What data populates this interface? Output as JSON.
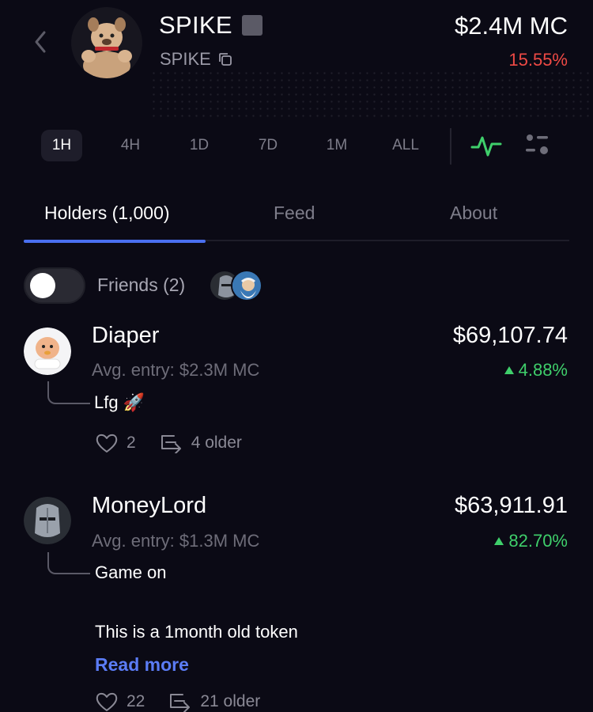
{
  "header": {
    "name": "SPIKE",
    "ticker": "SPIKE",
    "market_cap": "$2.4M MC",
    "change": "15.55%",
    "change_color": "#ef4a45"
  },
  "timeframes": [
    "1H",
    "4H",
    "1D",
    "7D",
    "1M",
    "ALL"
  ],
  "active_timeframe": "1H",
  "tabs": {
    "holders": "Holders (1,000)",
    "feed": "Feed",
    "about": "About"
  },
  "friends": {
    "label": "Friends (2)",
    "toggle_on": false
  },
  "holders": [
    {
      "name": "Diaper",
      "entry": "Avg. entry: $2.3M MC",
      "value": "$69,107.74",
      "change": "4.88%",
      "comment": "Lfg 🚀",
      "likes": "2",
      "older": "4 older"
    },
    {
      "name": "MoneyLord",
      "entry": "Avg. entry: $1.3M MC",
      "value": "$63,911.91",
      "change": "82.70%",
      "comment_line1": "Game on",
      "comment_line2": "This is a 1month old token",
      "read_more": "Read more",
      "likes": "22",
      "older": "21 older"
    }
  ],
  "icons": {
    "back": "chevron-left-icon",
    "copy": "copy-icon",
    "pulse": "activity-pulse-icon",
    "settings": "sliders-icon",
    "heart": "heart-icon",
    "thread": "thread-reply-icon"
  },
  "colors": {
    "positive": "#3fcf6b",
    "negative": "#ef4a45",
    "accent": "#4a6ff0"
  }
}
